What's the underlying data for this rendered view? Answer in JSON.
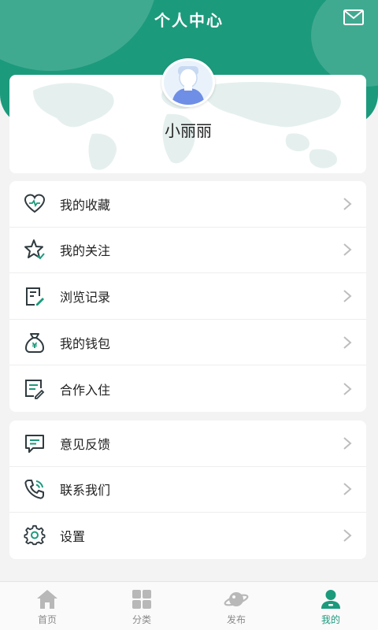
{
  "header": {
    "title": "个人中心"
  },
  "profile": {
    "username": "小丽丽"
  },
  "menu_group_1": [
    {
      "label": "我的收藏",
      "icon": "heart-icon"
    },
    {
      "label": "我的关注",
      "icon": "star-icon"
    },
    {
      "label": "浏览记录",
      "icon": "history-icon"
    },
    {
      "label": "我的钱包",
      "icon": "wallet-icon"
    },
    {
      "label": "合作入住",
      "icon": "cooperation-icon"
    }
  ],
  "menu_group_2": [
    {
      "label": "意见反馈",
      "icon": "feedback-icon"
    },
    {
      "label": "联系我们",
      "icon": "phone-icon"
    },
    {
      "label": "设置",
      "icon": "gear-icon"
    }
  ],
  "tabs": [
    {
      "label": "首页",
      "icon": "home-icon"
    },
    {
      "label": "分类",
      "icon": "grid-icon"
    },
    {
      "label": "发布",
      "icon": "planet-icon"
    },
    {
      "label": "我的",
      "icon": "user-icon",
      "active": true
    }
  ],
  "colors": {
    "accent": "#1c9a7c",
    "icon_dark": "#2f3a3f",
    "inactive": "#b8b8b8"
  }
}
